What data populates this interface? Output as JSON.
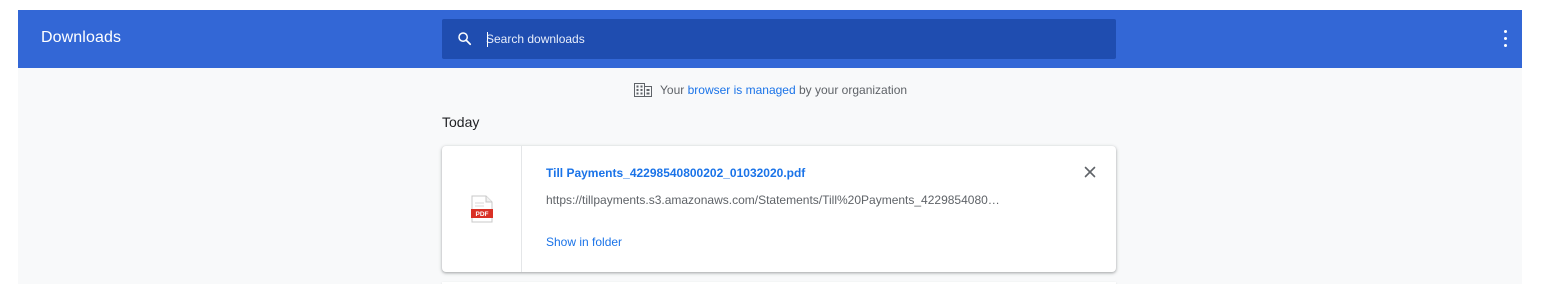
{
  "toolbar": {
    "title": "Downloads",
    "search_placeholder": "Search downloads",
    "more_label": "More actions"
  },
  "notice": {
    "prefix": "Your ",
    "link_text": "browser is managed",
    "suffix": " by your organization"
  },
  "sections": [
    {
      "date_label": "Today",
      "items": [
        {
          "file_name": "Till Payments_42298540800202_01032020.pdf",
          "url": "https://tillpayments.s3.amazonaws.com/Statements/Till%20Payments_4229854080…",
          "action_label": "Show in folder",
          "file_type_badge": "PDF",
          "remove_icon": "close-icon"
        }
      ]
    }
  ],
  "colors": {
    "toolbar_bg": "#3367d6",
    "search_bg": "#1f4db0",
    "page_bg": "#f8f9fa",
    "link": "#1a73e8",
    "pdf_red": "#d93025"
  }
}
